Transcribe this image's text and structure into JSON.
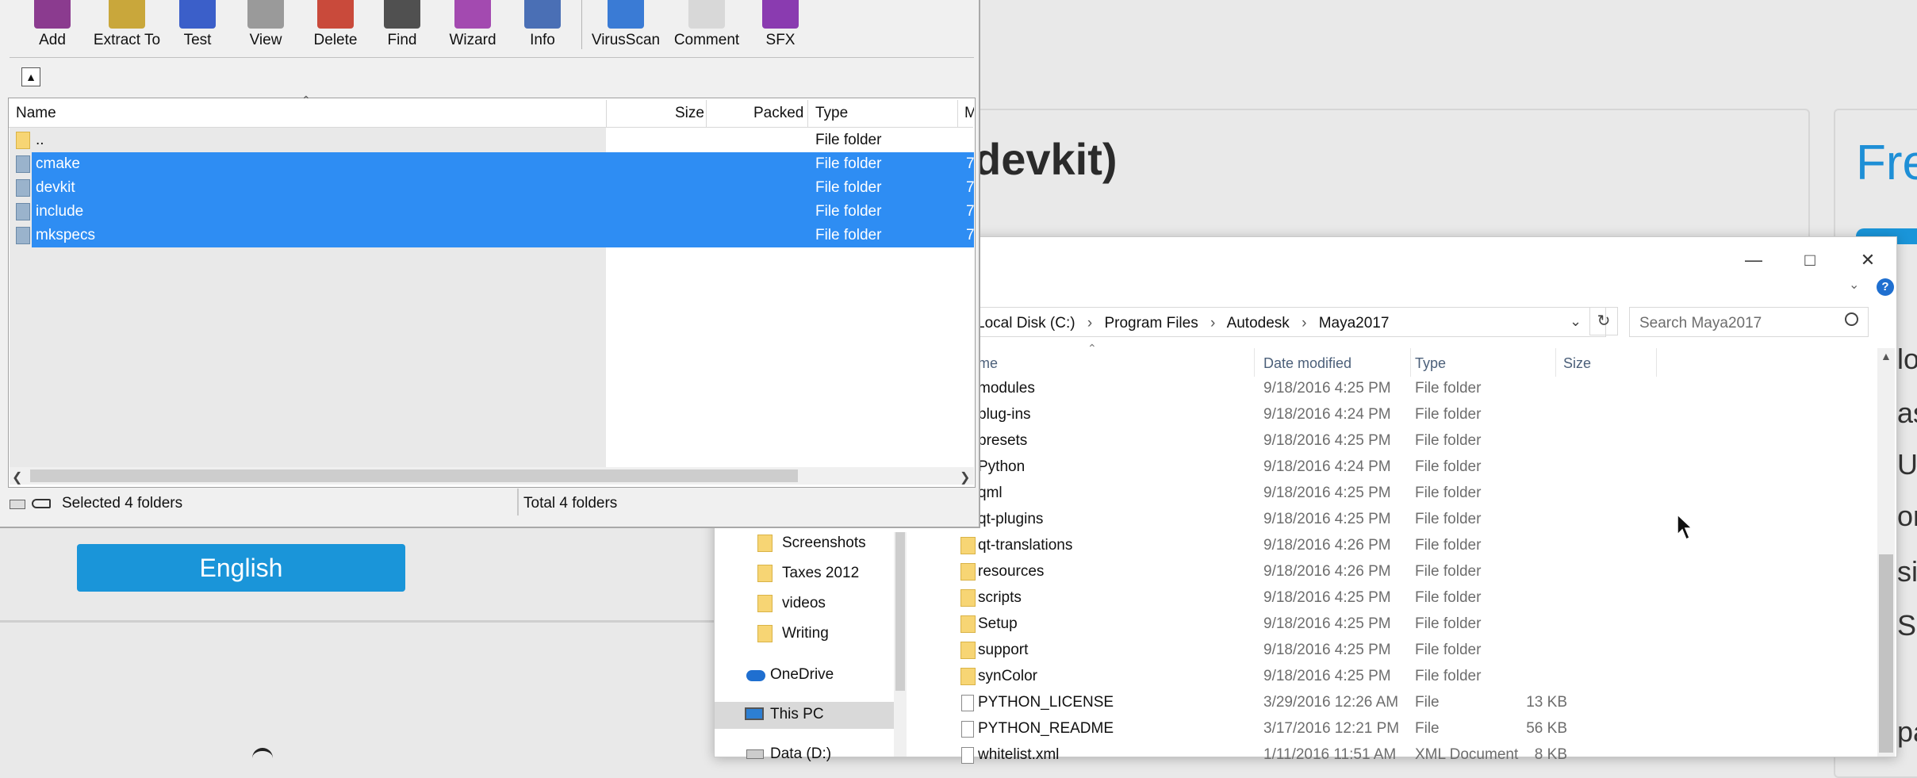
{
  "web": {
    "heading": "devkit)",
    "free_text": "Fre",
    "side_letters": [
      "lo",
      "as",
      "Up",
      "on",
      "site",
      "S",
      "pa"
    ],
    "language_button": "English"
  },
  "winrar": {
    "toolbar": [
      {
        "label": "Add",
        "icon": "add-archive-icon",
        "color": "#8b3b8f"
      },
      {
        "label": "Extract To",
        "icon": "extract-icon",
        "color": "#c9a73b"
      },
      {
        "label": "Test",
        "icon": "test-icon",
        "color": "#3b5fc9"
      },
      {
        "label": "View",
        "icon": "view-icon",
        "color": "#9a9a9a"
      },
      {
        "label": "Delete",
        "icon": "delete-icon",
        "color": "#c94a3b"
      },
      {
        "label": "Find",
        "icon": "find-icon",
        "color": "#505050"
      },
      {
        "label": "Wizard",
        "icon": "wizard-icon",
        "color": "#a34ab0"
      },
      {
        "label": "Info",
        "icon": "info-icon",
        "color": "#4a6fb5"
      },
      {
        "label": "VirusScan",
        "icon": "virusscan-icon",
        "color": "#3a7bd5"
      },
      {
        "label": "Comment",
        "icon": "comment-icon",
        "color": "#d8d8d8"
      },
      {
        "label": "SFX",
        "icon": "sfx-icon",
        "color": "#8a3bb0"
      }
    ],
    "columns": [
      "Name",
      "Size",
      "Packed",
      "Type",
      "M"
    ],
    "rows": [
      {
        "name": "..",
        "type": "File folder",
        "extra": "",
        "selected": false
      },
      {
        "name": "cmake",
        "type": "File folder",
        "extra": "7",
        "selected": true
      },
      {
        "name": "devkit",
        "type": "File folder",
        "extra": "7",
        "selected": true
      },
      {
        "name": "include",
        "type": "File folder",
        "extra": "7",
        "selected": true
      },
      {
        "name": "mkspecs",
        "type": "File folder",
        "extra": "7",
        "selected": true
      }
    ],
    "status_left": "Selected 4 folders",
    "status_right": "Total 4 folders"
  },
  "explorer": {
    "address": [
      "Local Disk (C:)",
      "Program Files",
      "Autodesk",
      "Maya2017"
    ],
    "search_placeholder": "Search Maya2017",
    "columns": [
      "me",
      "Date modified",
      "Type",
      "Size"
    ],
    "nav": [
      {
        "label": "Screenshots",
        "kind": "folder"
      },
      {
        "label": "Taxes 2012",
        "kind": "folder"
      },
      {
        "label": "videos",
        "kind": "folder"
      },
      {
        "label": "Writing",
        "kind": "folder"
      },
      {
        "label": "OneDrive",
        "kind": "cloud"
      },
      {
        "label": "This PC",
        "kind": "pc"
      },
      {
        "label": "Data (D:)",
        "kind": "drive"
      }
    ],
    "files": [
      {
        "name": "modules",
        "date": "9/18/2016 4:25 PM",
        "type": "File folder",
        "size": "",
        "kind": "folder"
      },
      {
        "name": "plug-ins",
        "date": "9/18/2016 4:24 PM",
        "type": "File folder",
        "size": "",
        "kind": "folder"
      },
      {
        "name": "presets",
        "date": "9/18/2016 4:25 PM",
        "type": "File folder",
        "size": "",
        "kind": "folder"
      },
      {
        "name": "Python",
        "date": "9/18/2016 4:24 PM",
        "type": "File folder",
        "size": "",
        "kind": "folder"
      },
      {
        "name": "qml",
        "date": "9/18/2016 4:25 PM",
        "type": "File folder",
        "size": "",
        "kind": "folder"
      },
      {
        "name": "qt-plugins",
        "date": "9/18/2016 4:25 PM",
        "type": "File folder",
        "size": "",
        "kind": "folder"
      },
      {
        "name": "qt-translations",
        "date": "9/18/2016 4:26 PM",
        "type": "File folder",
        "size": "",
        "kind": "folder"
      },
      {
        "name": "resources",
        "date": "9/18/2016 4:26 PM",
        "type": "File folder",
        "size": "",
        "kind": "folder"
      },
      {
        "name": "scripts",
        "date": "9/18/2016 4:25 PM",
        "type": "File folder",
        "size": "",
        "kind": "folder"
      },
      {
        "name": "Setup",
        "date": "9/18/2016 4:25 PM",
        "type": "File folder",
        "size": "",
        "kind": "folder"
      },
      {
        "name": "support",
        "date": "9/18/2016 4:25 PM",
        "type": "File folder",
        "size": "",
        "kind": "folder"
      },
      {
        "name": "synColor",
        "date": "9/18/2016 4:25 PM",
        "type": "File folder",
        "size": "",
        "kind": "folder"
      },
      {
        "name": "PYTHON_LICENSE",
        "date": "3/29/2016 12:26 AM",
        "type": "File",
        "size": "13 KB",
        "kind": "file"
      },
      {
        "name": "PYTHON_README",
        "date": "3/17/2016 12:21 PM",
        "type": "File",
        "size": "56 KB",
        "kind": "file"
      },
      {
        "name": "whitelist.xml",
        "date": "1/11/2016 11:51 AM",
        "type": "XML Document",
        "size": "8 KB",
        "kind": "file"
      }
    ]
  }
}
